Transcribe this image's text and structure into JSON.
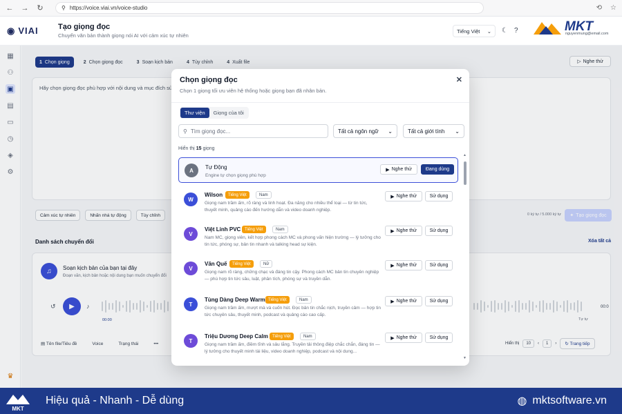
{
  "browser": {
    "url": "https://voice.viai.vn/voice-studio"
  },
  "header": {
    "logo": "VIAI",
    "title": "Tạo giọng đọc",
    "subtitle": "Chuyển văn bản thành giọng nói AI với cảm xúc tự nhiên",
    "language": "Tiếng Việt",
    "email": "nguyenmung@email.com"
  },
  "brand": {
    "name": "MKT"
  },
  "steps": [
    {
      "num": "1",
      "label": "Chọn giọng"
    },
    {
      "num": "2",
      "label": "Chọn giọng đọc"
    },
    {
      "num": "3",
      "label": "Soạn kịch bản"
    },
    {
      "num": "4",
      "label": "Tùy chỉnh"
    },
    {
      "num": "4",
      "label": "Xuất file"
    }
  ],
  "try_button": "Nghe thử",
  "editor": {
    "placeholder": "Hãy chọn giọng đọc phù hợp với nội dung và mục đích sử d"
  },
  "emotion_buttons": [
    "Cảm xúc tự nhiên",
    "Nhấn nhá tự động",
    "Tùy chỉnh"
  ],
  "char_count": "0 ký tự / 5.000 ký tự",
  "create_button": "Tạo giọng đọc",
  "conversion_list": {
    "title": "Danh sách chuyển đổi",
    "clear_all": "Xóa tất cả",
    "card_title": "Soạn kịch bản của bạn tại đây",
    "card_sub": "Đoạn văn, kịch bản hoặc nội dung bạn muốn chuyển đổi",
    "time_start": "00:00",
    "time_end": "Tự tự",
    "time_right": "00:0",
    "columns": [
      "Tên file/Tiêu đề",
      "Voice",
      "Trạng thái",
      "•••"
    ],
    "per_page_label": "Hiển thị",
    "per_page": "10",
    "page": "1",
    "next": "Trang tiếp"
  },
  "modal": {
    "title": "Chọn giọng đọc",
    "subtitle": "Chọn 1 giọng tối ưu viên hệ thống hoặc giọng bạn đã nhân bản.",
    "tabs": [
      "Thư viện",
      "Giọng của tôi"
    ],
    "search_placeholder": "Tìm giọng đọc...",
    "filter_language": "Tất cả ngôn ngữ",
    "filter_gender": "Tất cả giới tính",
    "count_prefix": "Hiển thị",
    "count": "15",
    "count_suffix": "giọng",
    "listen_label": "Nghe thử",
    "use_label": "Sử dụng",
    "using_label": "Đang dùng",
    "voices": [
      {
        "initial": "A",
        "name": "Tự Động",
        "lang": "",
        "gender": "",
        "desc": "Engine tự chọn giọng phù hợp",
        "color": "#6b7280"
      },
      {
        "initial": "W",
        "name": "Wilson",
        "lang": "Tiếng Việt",
        "gender": "Nam",
        "desc": "Giọng nam trầm ấm, rõ ràng và linh hoạt. Đa năng cho nhiều thể loại — từ tin tức, thuyết minh, quảng cáo đến hướng dẫn và video doanh nghiệp.",
        "color": "#3b4fd8"
      },
      {
        "initial": "V",
        "name": "Việt Linh PVC",
        "lang": "Tiếng Việt",
        "gender": "Nam",
        "desc": "Nam MC, giọng viên, kết hợp phong cách MC và phong vấn hiện trường — lý tưởng cho tin tức, phóng sự, bản tin nhanh và talking head sự kiện.",
        "color": "#6d4bd8"
      },
      {
        "initial": "V",
        "name": "Văn Quế",
        "lang": "Tiếng Việt",
        "gender": "Nữ",
        "desc": "Giọng nam rõ ràng, chững chạc và đáng tin cậy. Phong cách MC bản tin chuyên nghiệp — phù hợp tin tức sâu, luật, phân tích, phóng sự và truyền dẫn.",
        "color": "#6d4bd8"
      },
      {
        "initial": "T",
        "name": "Tùng Dàng Deep Warm",
        "lang": "Tiếng Việt",
        "gender": "Nam",
        "desc": "Giọng nam trầm ấm, mượt mà và cuốn hút. Đọc bản tin chắc nịch, truyền cảm — hợp tin tức chuyên sâu, thuyết minh, podcast và quảng cáo cao cấp.",
        "color": "#3b4fd8"
      },
      {
        "initial": "T",
        "name": "Triệu Dương Deep Calm",
        "lang": "Tiếng Việt",
        "gender": "Nam",
        "desc": "Giọng nam trầm ấm, điềm tĩnh và sâu lắng. Truyền tải thông điệp chắc chắn, đáng tin — lý tưởng cho thuyết minh tài liệu, video doanh nghiệp, podcast và nội dung...",
        "color": "#6d4bd8"
      }
    ]
  },
  "footer": {
    "logo": "MKT",
    "slogan": "Hiệu quả - Nhanh - Dễ dùng",
    "website": "mktsoftware.vn"
  }
}
